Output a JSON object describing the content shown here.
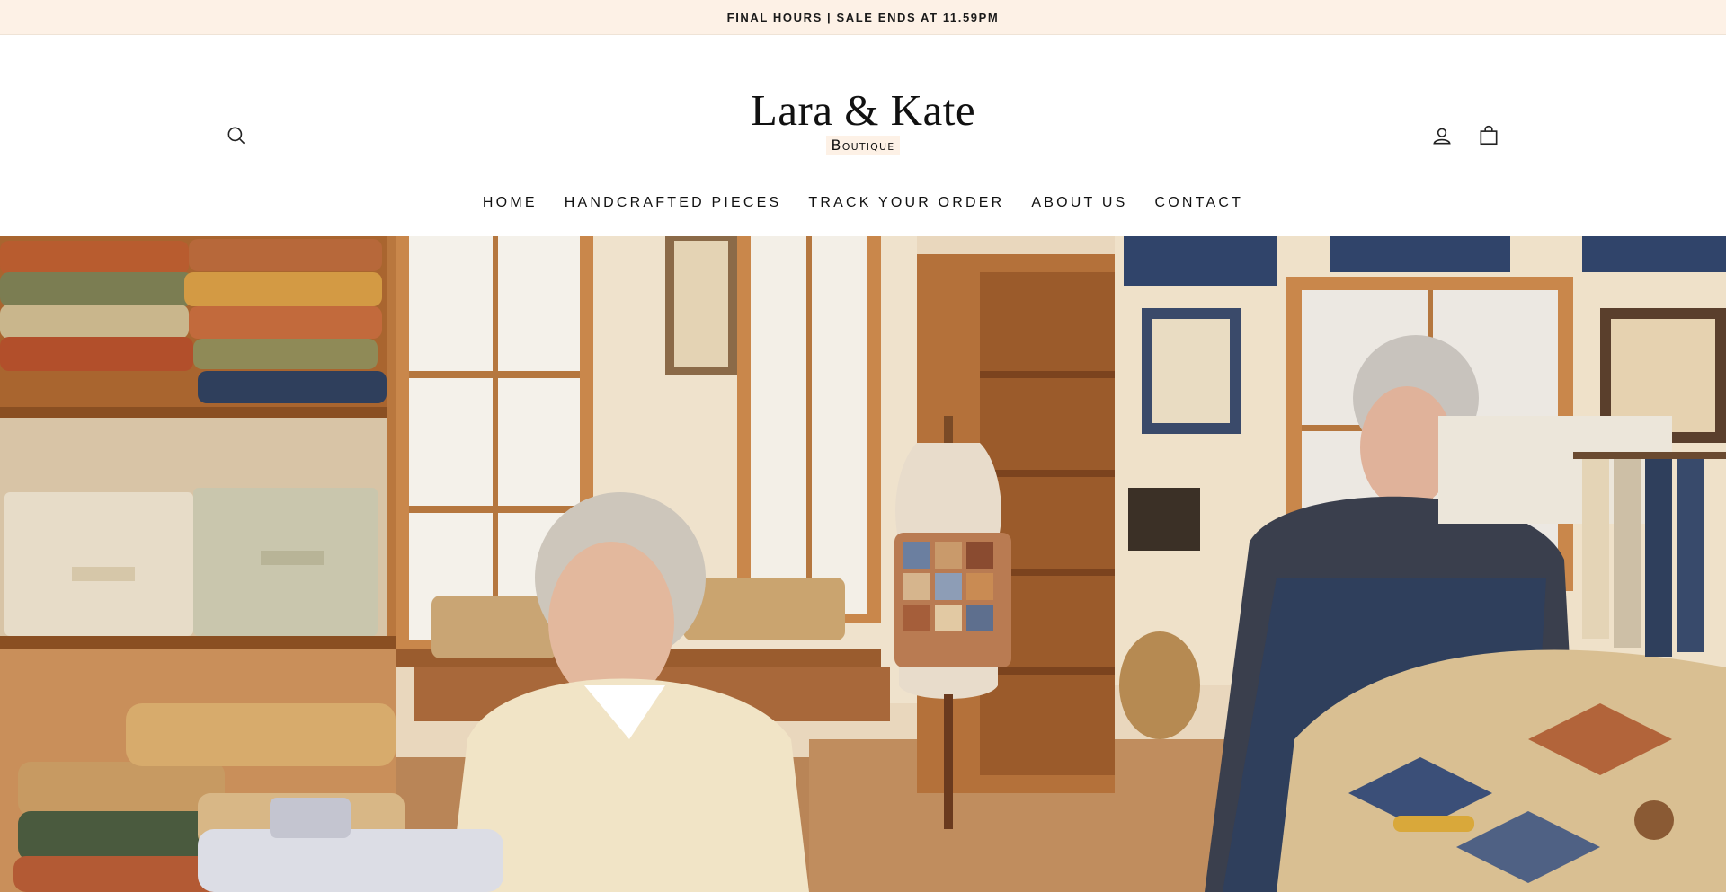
{
  "announcement": {
    "text": "FINAL HOURS | SALE ENDS AT 11.59PM"
  },
  "header": {
    "logo_title": "Lara & Kate",
    "logo_subtitle": "Boutique",
    "icons": {
      "search": "search-icon",
      "account": "user-icon",
      "cart": "shopping-bag-icon"
    }
  },
  "nav": {
    "items": [
      {
        "label": "HOME"
      },
      {
        "label": "HANDCRAFTED PIECES"
      },
      {
        "label": "TRACK YOUR ORDER"
      },
      {
        "label": "ABOUT US"
      },
      {
        "label": "CONTACT"
      }
    ]
  },
  "hero": {
    "image": "quilt-shop-interior-photo",
    "colors": {
      "wood": "#b9773e",
      "wall": "#efe2cc",
      "floor": "#b98557",
      "denim": "#2f3f5c",
      "cream": "#efe6d2"
    }
  }
}
